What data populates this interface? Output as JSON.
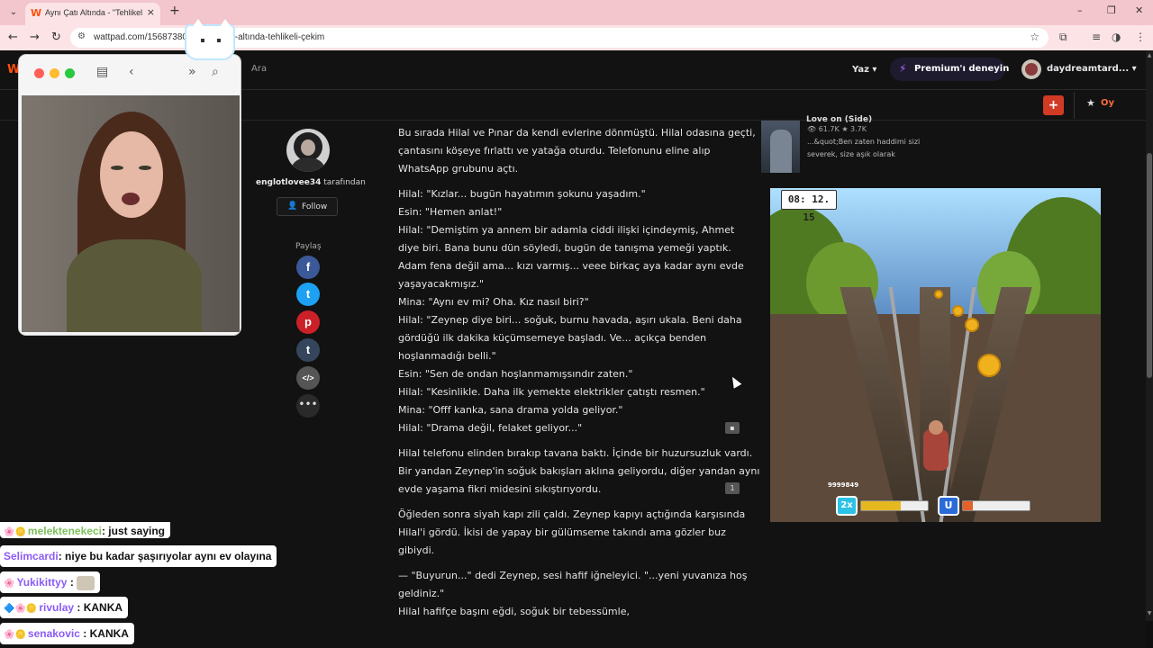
{
  "browser": {
    "tab_title": "Aynı Çatı Altında - \"Tehlikeli çe",
    "url": "wattpad.com/1568738055-aynı-çatı-altında-tehlikeli-çekim",
    "new_tab": "+",
    "close_tab": "×",
    "window_minimize": "–",
    "window_maximize": "❐",
    "window_close": "✕"
  },
  "header": {
    "logo": "W",
    "search_label": "Ara",
    "write_label": "Yaz ▾",
    "premium_label": "Premium'ı deneyin",
    "username": "daydreamtard... ▾"
  },
  "story_bar": {
    "add_label": "+",
    "vote_label": "Oy"
  },
  "author": {
    "name": "englotlovee34",
    "by_label": " tarafından",
    "follow_label": "Follow",
    "share_label": "Paylaş"
  },
  "share": [
    {
      "name": "facebook",
      "glyph": "f",
      "color": "#3b5998"
    },
    {
      "name": "twitter",
      "glyph": "t",
      "color": "#1da1f2"
    },
    {
      "name": "pinterest",
      "glyph": "p",
      "color": "#cb2027"
    },
    {
      "name": "tumblr",
      "glyph": "t",
      "color": "#35465c"
    },
    {
      "name": "embed",
      "glyph": "</>",
      "color": "#555555"
    }
  ],
  "story": {
    "p1": [
      "Bu sırada Hilal ve Pınar da kendi evlerine dönmüştü. Hilal odasına geçti,",
      "çantasını köşeye fırlattı ve yatağa oturdu. Telefonunu eline alıp",
      "WhatsApp grubunu açtı."
    ],
    "p2": [
      "Hilal: \"Kızlar... bugün hayatımın şokunu yaşadım.\"",
      "Esin: \"Hemen anlat!\"",
      "Hilal: \"Demiştim ya annem bir adamla ciddi ilişki içindeymiş, Ahmet",
      "diye biri. Bana bunu dün söyledi, bugün de tanışma yemeği yaptık.",
      "Adam fena değil ama... kızı varmış... veee birkaç aya kadar aynı evde",
      "yaşayacakmışız.\"",
      "Mina: \"Aynı ev mi? Oha. Kız nasıl biri?\"",
      "Hilal: \"Zeynep diye biri... soğuk, burnu havada, aşırı ukala. Beni daha",
      "gördüğü ilk dakika küçümsemeye başladı. Ve... açıkça benden",
      "hoşlanmadığı belli.\"",
      "Esin: \"Sen de ondan hoşlanmamışsındır zaten.\"",
      "Hilal: \"Kesinlikle. Daha ilk yemekte elektrikler çatıştı resmen.\"",
      "Mina: \"Offf kanka, sana drama yolda geliyor.\"",
      "Hilal: \"Drama değil, felaket geliyor...\""
    ],
    "p3": [
      "Hilal telefonu elinden bırakıp tavana baktı. İçinde bir huzursuzluk vardı.",
      "Bir yandan Zeynep'in soğuk bakışları aklına geliyordu, diğer yandan aynı",
      "evde yaşama fikri midesini sıkıştırıyordu."
    ],
    "p4": [
      "Öğleden sonra siyah kapı zili çaldı. Zeynep kapıyı açtığında karşısında",
      "Hilal'i gördü. İkisi de yapay bir gülümseme takındı ama gözler buz",
      "gibiydi."
    ],
    "p5": [
      "— \"Buyurun...\" dedi Zeynep, sesi hafif iğneleyici. \"...yeni yuvanıza hoş",
      "geldiniz.\"",
      "Hilal hafifçe başını eğdi, soğuk bir tebessümle,"
    ],
    "comment_count": "1"
  },
  "recommended": {
    "title": "Love on (Side)",
    "reads": "61.7K",
    "votes": "3.7K",
    "description": "...&quot;Ben zaten haddimi sizi severek, size aşık olarak"
  },
  "game": {
    "timer": "08: 12. 15",
    "score": "9999849",
    "multiplier": "2x",
    "multiplier_level": 0.6,
    "magnet_level": 0.15
  },
  "chat": [
    {
      "user": "melektenekeci",
      "message": ": just saying",
      "badge": "🌸🪙"
    },
    {
      "user": "Selimcardi",
      "message": ": niye bu kadar şaşırıyolar aynı ev olayına",
      "badge": ""
    },
    {
      "user": "Yukikittyy",
      "message": " : ",
      "badge": "🌸"
    },
    {
      "user": "rivulay",
      "message": " : KANKA",
      "badge": "🔷🌸🪙"
    },
    {
      "user": "senakovic",
      "message": " : KANKA",
      "badge": "🌸🪙"
    }
  ]
}
